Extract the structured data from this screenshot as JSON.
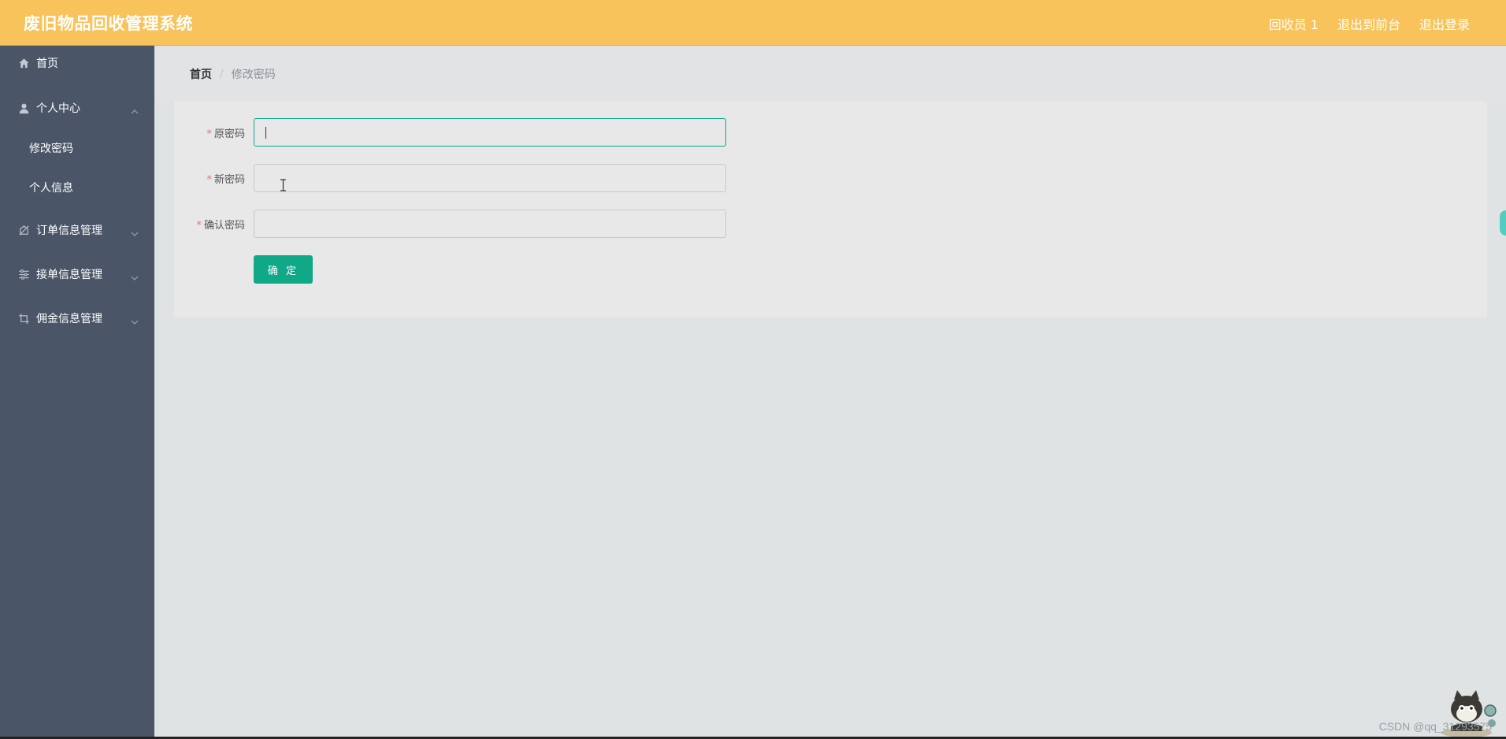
{
  "header": {
    "title": "废旧物品回收管理系统",
    "links": [
      {
        "label": "回收员 1"
      },
      {
        "label": "退出到前台"
      },
      {
        "label": "退出登录"
      }
    ],
    "background_color": "#f8c35a"
  },
  "sidebar": {
    "background_color": "#4a5568",
    "items": [
      {
        "label": "首页",
        "icon": "home-icon"
      },
      {
        "label": "个人中心",
        "icon": "user-icon",
        "expanded": true,
        "children": [
          {
            "label": "修改密码",
            "active": true
          },
          {
            "label": "个人信息"
          }
        ]
      },
      {
        "label": "订单信息管理",
        "icon": "order-icon",
        "expanded": false
      },
      {
        "label": "接单信息管理",
        "icon": "sliders-icon",
        "expanded": false
      },
      {
        "label": "佣金信息管理",
        "icon": "crop-icon",
        "expanded": false
      }
    ]
  },
  "breadcrumb": {
    "home": "首页",
    "separator": "/",
    "current": "修改密码"
  },
  "form": {
    "required_mark": "*",
    "fields": [
      {
        "label": "原密码",
        "value": "",
        "focused": true
      },
      {
        "label": "新密码",
        "value": ""
      },
      {
        "label": "确认密码",
        "value": ""
      }
    ],
    "submit_label": "确 定",
    "accent_color": "#10a987"
  },
  "watermark": "CSDN @qq_31293575"
}
